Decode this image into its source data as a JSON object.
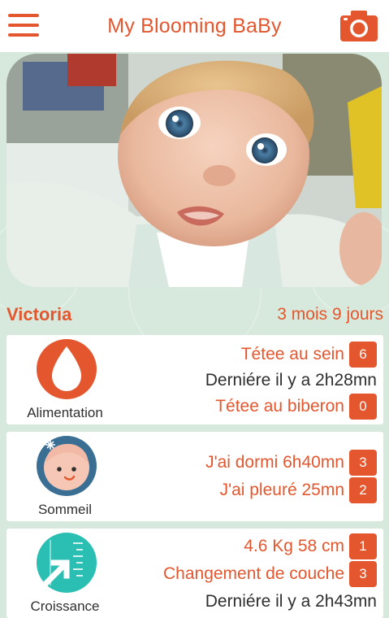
{
  "header": {
    "title": "My Blooming BaBy",
    "menu_icon": "hamburger-menu-icon",
    "camera_icon": "camera-icon"
  },
  "profile": {
    "name": "Victoria",
    "age": "3 mois 9 jours"
  },
  "cards": {
    "feeding": {
      "label": "Alimentation",
      "icon": "milk-drop-icon",
      "breast": {
        "text": "Tétee au sein",
        "count": "6"
      },
      "last": {
        "text": "Derniére il y a 2h28mn"
      },
      "bottle": {
        "text": "Tétee au biberon",
        "count": "0"
      }
    },
    "sleep": {
      "label": "Sommeil",
      "icon": "sleeping-baby-icon",
      "slept": {
        "text": "J'ai dormi 6h40mn",
        "count": "3"
      },
      "cried": {
        "text": "J'ai pleuré 25mn",
        "count": "2"
      }
    },
    "growth": {
      "label": "Croissance",
      "icon": "growth-ruler-icon",
      "measure": {
        "text": "4.6 Kg 58 cm",
        "count": "1"
      },
      "diaper": {
        "text": "Changement de couche",
        "count": "3"
      },
      "last": {
        "text": "Derniére il y a 2h43mn"
      }
    }
  },
  "colors": {
    "accent": "#e4572e",
    "background": "#d7e9dc",
    "text_dark": "#2f2f2f",
    "growth_teal": "#2bbfb3",
    "sleep_blue": "#3a6f93"
  }
}
